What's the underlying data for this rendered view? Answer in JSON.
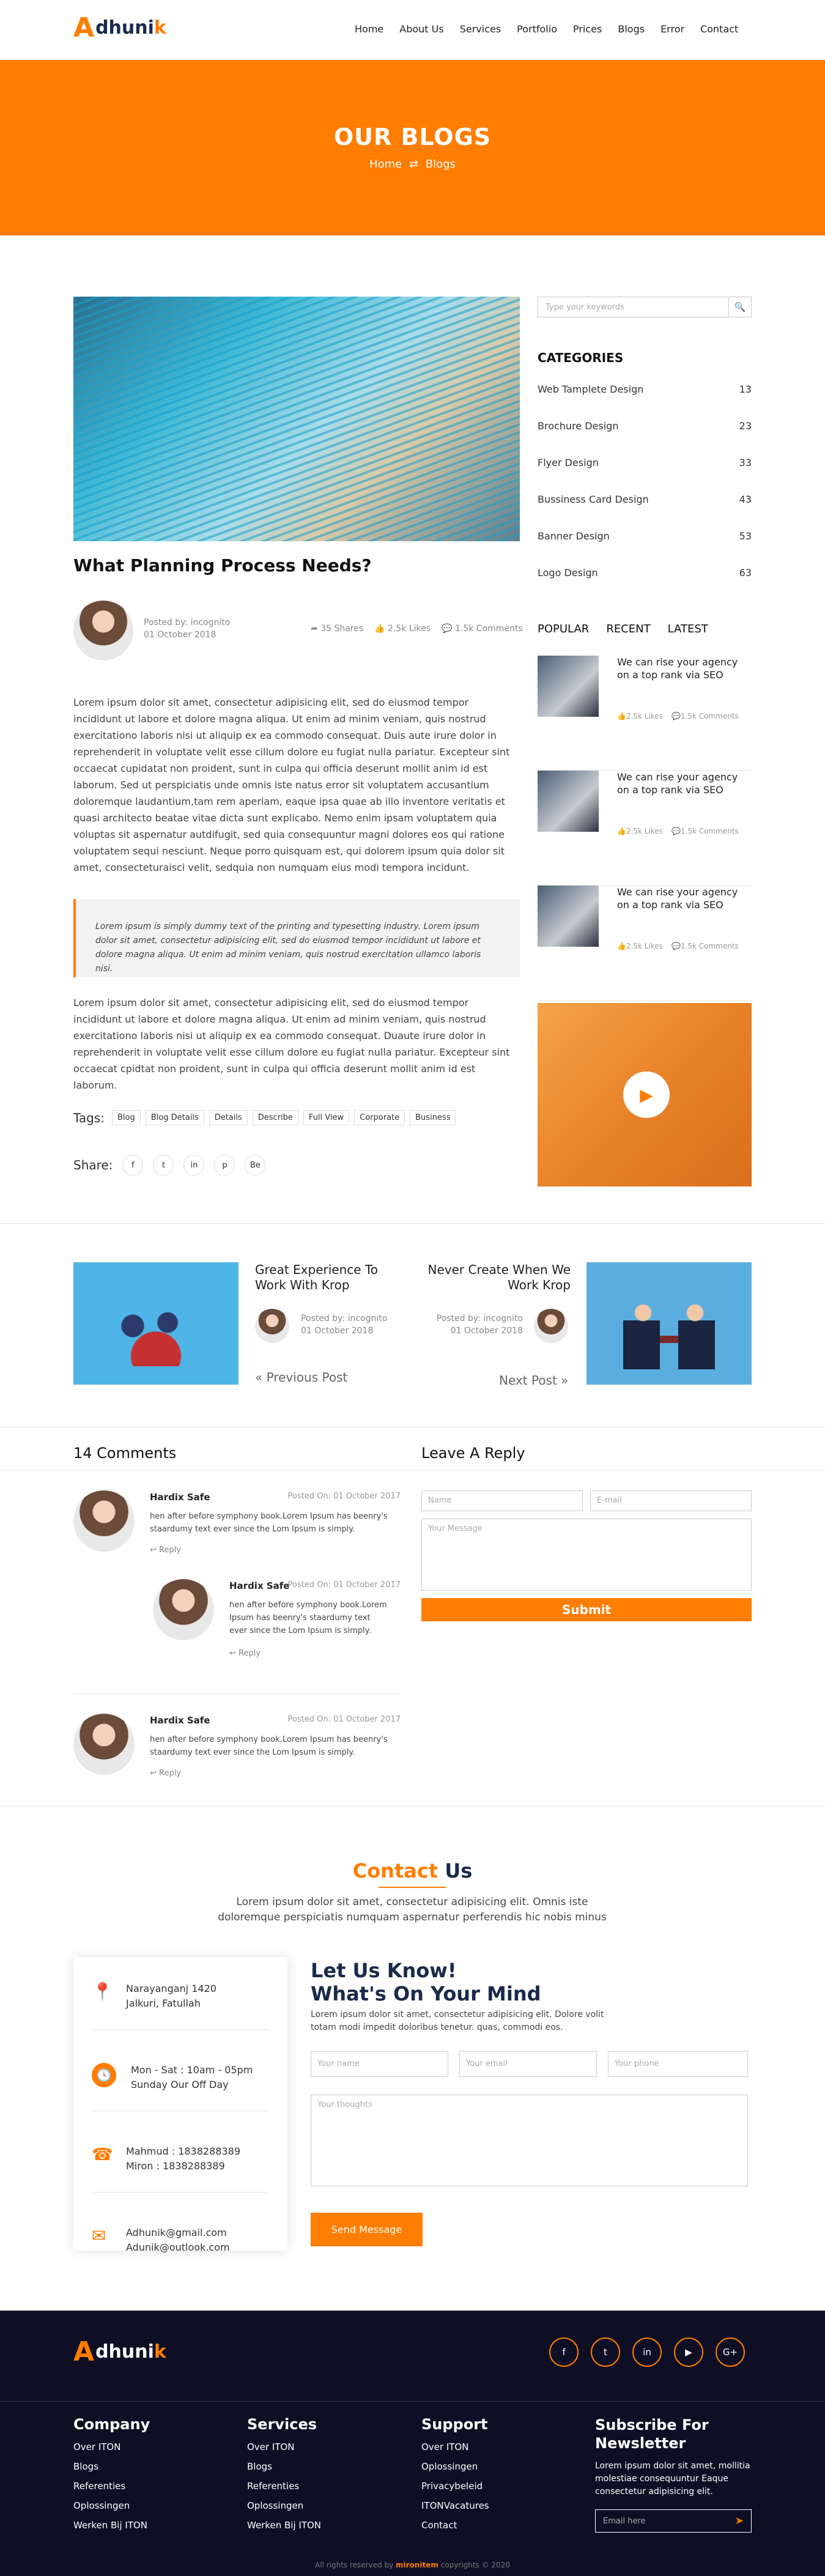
{
  "nav": {
    "logo_a": "A",
    "logo_text": "dhuni",
    "logo_k": "k",
    "items": [
      "Home",
      "About Us",
      "Services",
      "Portfolio",
      "Prices",
      "Blogs",
      "Error",
      "Contact"
    ]
  },
  "hero": {
    "title": "OUR BLOGS",
    "crumb_home": "Home",
    "crumb_sep": "⇄",
    "crumb_current": "Blogs"
  },
  "post": {
    "title": "What Planning Process Needs?",
    "posted_by": "Posted by: incognito",
    "date": "01 October 2018",
    "shares": "35 Shares",
    "likes": "2.5k Likes",
    "comments": "1.5k Comments",
    "para1": "Lorem ipsum dolor sit amet, consectetur adipisicing elit, sed do eiusmod tempor incididunt ut labore et dolore magna aliqua. Ut enim ad minim veniam, quis nostrud exercitationo laboris nisi ut aliquip ex ea commodo consequat. Duis aute irure dolor in reprehenderit in voluptate velit esse cillum dolore eu fugiat nulla pariatur. Excepteur sint occaecat cupidatat non proident, sunt in culpa qui officia deserunt mollit anim id est laborum. Sed ut perspiciatis unde omnis iste natus error sit voluptatem accusantium doloremque laudantium,tam rem aperiam, eaque ipsa quae ab illo inventore veritatis et quasi architecto beatae vitae dicta sunt explicabo. Nemo enim ipsam voluptatem quia voluptas sit aspernatur autdifugit, sed quia consequuntur magni dolores eos qui ratione voluptatem sequi nesciunt. Neque porro quisquam est, qui dolorem ipsum quia dolor sit amet, consecteturaisci velit, sedquia non numquam eius modi tempora incidunt.",
    "quote": "Lorem ipsum is simply dummy text of the printing and typesetting industry. Lorem ipsum dolor sit amet, consectetur adipisicing elit, sed do eiusmod tempor incididunt ut labore et dolore magna aliqua. Ut enim ad minim veniam, quis nostrud exercitation ullamco laboris nisi.",
    "para2": "Lorem ipsum dolor sit amet, consectetur adipisicing elit, sed do eiusmod tempor incididunt ut labore et dolore magna aliqua. Ut enim ad minim veniam, quis nostrud exercitationo laboris nisi ut aliquip ex ea commodo consequat. Duaute irure dolor in reprehenderit in voluptate velit esse cillum dolore eu fugiat nulla pariatur. Excepteur sint occaecat cpidtat non proident, sunt in culpa qui officia deserunt mollit anim id est laborum.",
    "tags_label": "Tags:",
    "tags": [
      "Blog",
      "Blog Details",
      "Details",
      "Describe",
      "Full View",
      "Corporate",
      "Business"
    ],
    "share_label": "Share:",
    "share_icons": [
      "f",
      "t",
      "in",
      "p",
      "Be"
    ]
  },
  "sidebar": {
    "search_placeholder": "Type your keywords",
    "categories_title": "CATEGORIES",
    "categories": [
      {
        "name": "Web Tamplete Design",
        "count": "13"
      },
      {
        "name": "Brochure Design",
        "count": "23"
      },
      {
        "name": "Flyer Design",
        "count": "33"
      },
      {
        "name": "Bussiness Card Design",
        "count": "43"
      },
      {
        "name": "Banner Design",
        "count": "53"
      },
      {
        "name": "Logo Design",
        "count": "63"
      }
    ],
    "tabs": [
      "POPULAR",
      "RECENT",
      "LATEST"
    ],
    "posts": [
      {
        "title": "We can rise your agency on a top rank via SEO",
        "likes": "2.5k Likes",
        "comments": "1.5k Comments"
      },
      {
        "title": "We can rise your agency on a top rank via SEO",
        "likes": "2.5k Likes",
        "comments": "1.5k Comments"
      },
      {
        "title": "We can rise your agency on a top rank via SEO",
        "likes": "2.5k Likes",
        "comments": "1.5k Comments"
      }
    ]
  },
  "nav_posts": {
    "prev": {
      "title": "Great Experience To Work With Krop",
      "by": "Posted by: incognito",
      "date": "01 October 2018",
      "link": "« Previous Post"
    },
    "next": {
      "title": "Never Create When We Work Krop",
      "by": "Posted by: incognito",
      "date": "01 October 2018",
      "link": "Next Post »"
    }
  },
  "comments": {
    "title": "14 Comments",
    "list": [
      {
        "name": "Hardix Safe",
        "date": "Posted On: 01 October 2017",
        "text": "hen after before symphony book.Lorem Ipsum has beenry's staardumy text ever since the Lom Ipsum is simply.",
        "reply": "Reply"
      },
      {
        "name": "Hardix Safe",
        "date": "Posted On: 01 October 2017",
        "text": "hen after before symphony book.Lorem Ipsum has beenry's staardumy text ever since the Lom Ipsum is simply.",
        "reply": "Reply"
      },
      {
        "name": "Hardix Safe",
        "date": "Posted On: 01 October 2017",
        "text": "hen after before symphony book.Lorem Ipsum has beenry's staardumy text ever since the Lom Ipsum is simply.",
        "reply": "Reply"
      }
    ]
  },
  "reply_form": {
    "title": "Leave A Reply",
    "name_ph": "Name",
    "email_ph": "E-mail",
    "message_ph": "Your Message",
    "submit": "Submit"
  },
  "contact": {
    "title_accent": "Contact",
    "title_rest": " Us",
    "intro": "Lorem ipsum dolor sit amet, consectetur adipisicing elit. Omnis iste doloremque perspiciatis numquam aspernatur perferendis hic nobis minus",
    "info": [
      {
        "line1": "Narayanganj 1420",
        "line2": "Jalkuri, Fatullah"
      },
      {
        "line1": "Mon - Sat : 10am - 05pm",
        "line2": "Sunday Our Off Day"
      },
      {
        "line1": "Mahmud : 1838288389",
        "line2": "Miron : 1838288389"
      },
      {
        "line1": "Adhunik@gmail.com",
        "line2": "Adunik@outlook.com"
      }
    ],
    "form_title1": "Let Us Know!",
    "form_title2": "What's On Your Mind",
    "form_text": "Lorem ipsum dolor sit amet, consectetur adipisicing elit. Dolore volit totam modi impedit doloribus tenetur. quas, commodi eos.",
    "name_ph": "Your name",
    "email_ph": "Your email",
    "phone_ph": "Your phone",
    "thoughts_ph": "Your thoughts",
    "send": "Send Message"
  },
  "footer": {
    "social": [
      "f",
      "t",
      "in",
      "▶",
      "G+"
    ],
    "company_title": "Company",
    "company": [
      "Over ITON",
      "Blogs",
      "Referenties",
      "Oplossingen",
      "Werken Bij ITON"
    ],
    "services_title": "Services",
    "services": [
      "Over ITON",
      "Blogs",
      "Referenties",
      "Oplossingen",
      "Werken Bij ITON"
    ],
    "support_title": "Support",
    "support": [
      "Over ITON",
      "Oplossingen",
      "Privacybeleid",
      "ITONVacatures",
      "Contact"
    ],
    "newsletter_title": "Subscribe For Newsletter",
    "newsletter_text": "Lorem ipsum dolor sit amet, mollitia molestiae consequuntur Eaque consectetur adipisicing elit.",
    "email_ph": "Email here",
    "copy_pre": "All rights reserved by ",
    "copy_brand": "mironitem",
    "copy_post": " copyrights © 2020",
    "colors": {
      "accent": "#ff7d00",
      "dark": "#0e0f25"
    }
  }
}
